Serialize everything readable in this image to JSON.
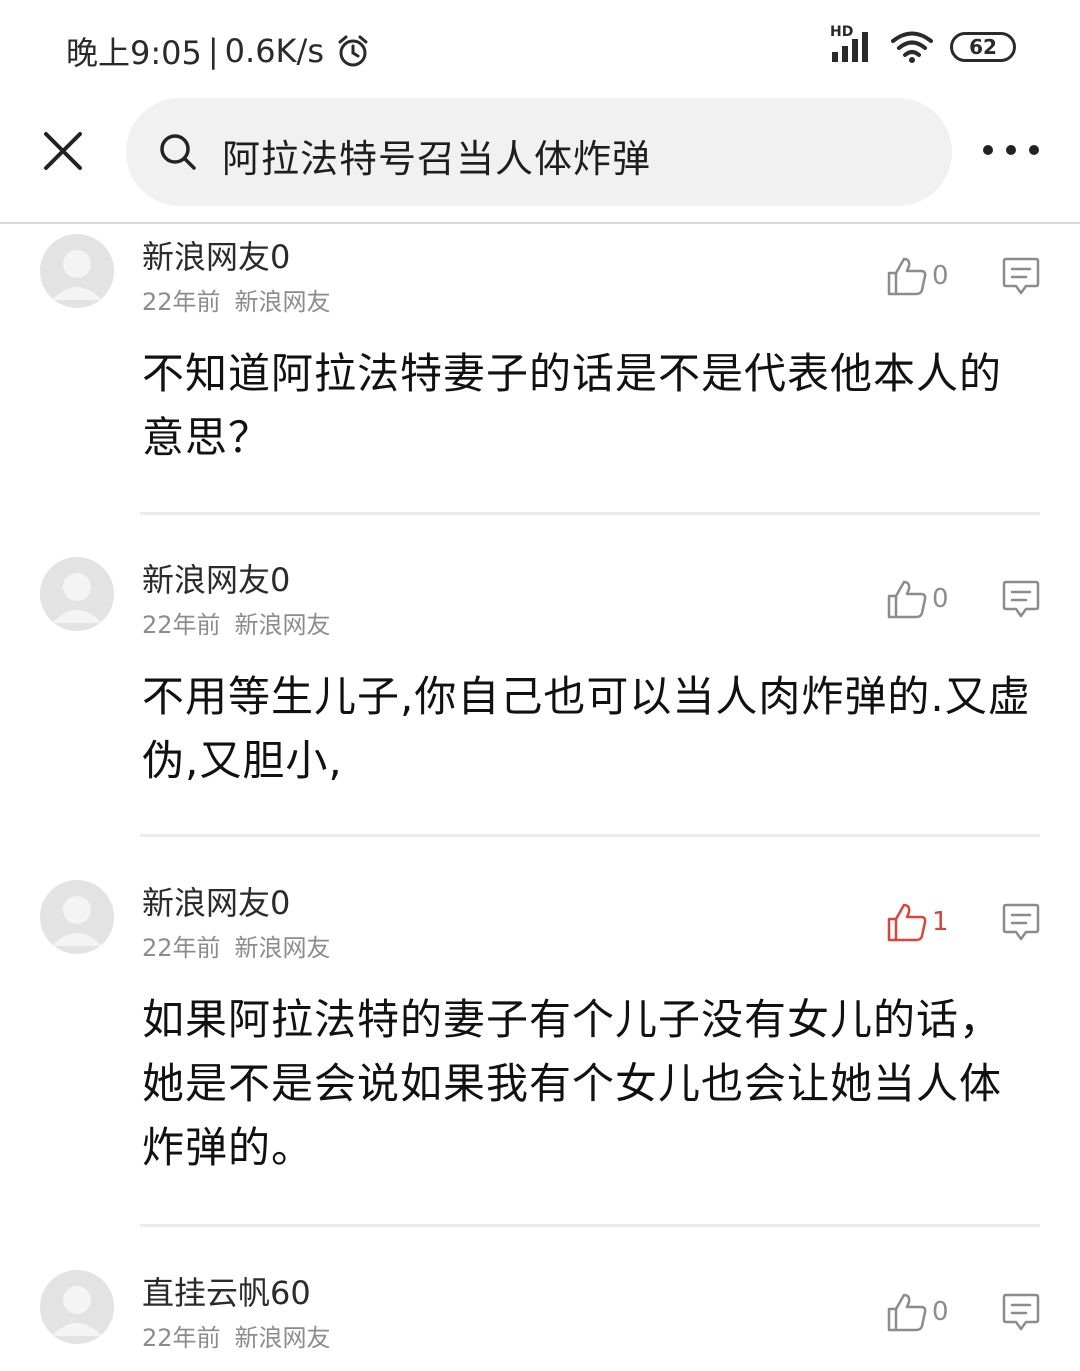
{
  "status_bar": {
    "time": "晚上9:05",
    "separator": "|",
    "speed": "0.6K/s",
    "network_label": "HD",
    "battery": "62",
    "icons": [
      "alarm-icon",
      "signal-icon",
      "wifi-icon",
      "battery-icon"
    ]
  },
  "top_bar": {
    "search_query": "阿拉法特号召当人体炸弹",
    "icons": [
      "close-icon",
      "search-icon",
      "more-icon"
    ]
  },
  "comments": [
    {
      "user": "新浪网友0",
      "time": "22年前",
      "source": "新浪网友",
      "likes": "0",
      "liked": false,
      "text": "不知道阿拉法特妻子的话是不是代表他本人的意思？"
    },
    {
      "user": "新浪网友0",
      "time": "22年前",
      "source": "新浪网友",
      "likes": "0",
      "liked": false,
      "text": "不用等生儿子,你自己也可以当人肉炸弹的.又虚伪,又胆小,"
    },
    {
      "user": "新浪网友0",
      "time": "22年前",
      "source": "新浪网友",
      "likes": "1",
      "liked": true,
      "text": "如果阿拉法特的妻子有个儿子没有女儿的话，她是不是会说如果我有个女儿也会让她当人体炸弹的。"
    },
    {
      "user": "直挂云帆60",
      "time": "22年前",
      "source": "新浪网友",
      "likes": "0",
      "liked": false,
      "text": ""
    }
  ],
  "colors": {
    "liked": "#d9453c",
    "icon_gray": "#8c8c8c",
    "divider": "#ececec"
  }
}
